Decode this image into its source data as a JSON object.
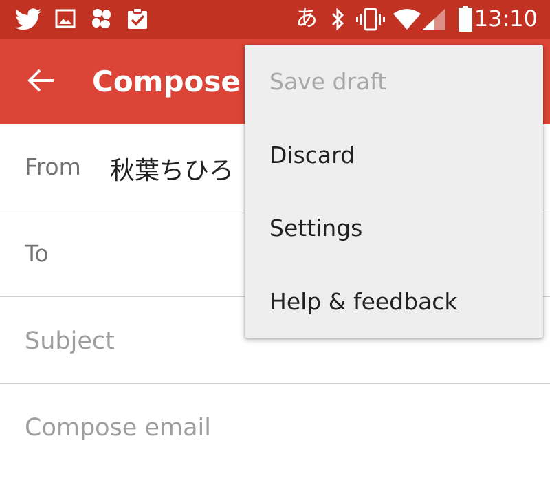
{
  "status_bar": {
    "left_icons": [
      "twitter-icon",
      "gallery-icon",
      "pinwheel-icon",
      "clipboard-check-icon"
    ],
    "ime_indicator": "あ",
    "right_icons": [
      "bluetooth-icon",
      "vibrate-icon",
      "wifi-icon",
      "cellular-signal-icon",
      "battery-icon"
    ],
    "time": "13:10",
    "background_color": "#c23222"
  },
  "app_bar": {
    "back_icon": "arrow-back-icon",
    "title": "Compose",
    "background_color": "#db4437"
  },
  "compose": {
    "from_label": "From",
    "from_value": "秋葉ちひろ",
    "to_label": "To",
    "subject_placeholder": "Subject",
    "body_placeholder": "Compose email"
  },
  "overflow_menu": {
    "items": [
      {
        "label": "Save draft",
        "enabled": false
      },
      {
        "label": "Discard",
        "enabled": true
      },
      {
        "label": "Settings",
        "enabled": true
      },
      {
        "label": "Help & feedback",
        "enabled": true
      }
    ]
  }
}
